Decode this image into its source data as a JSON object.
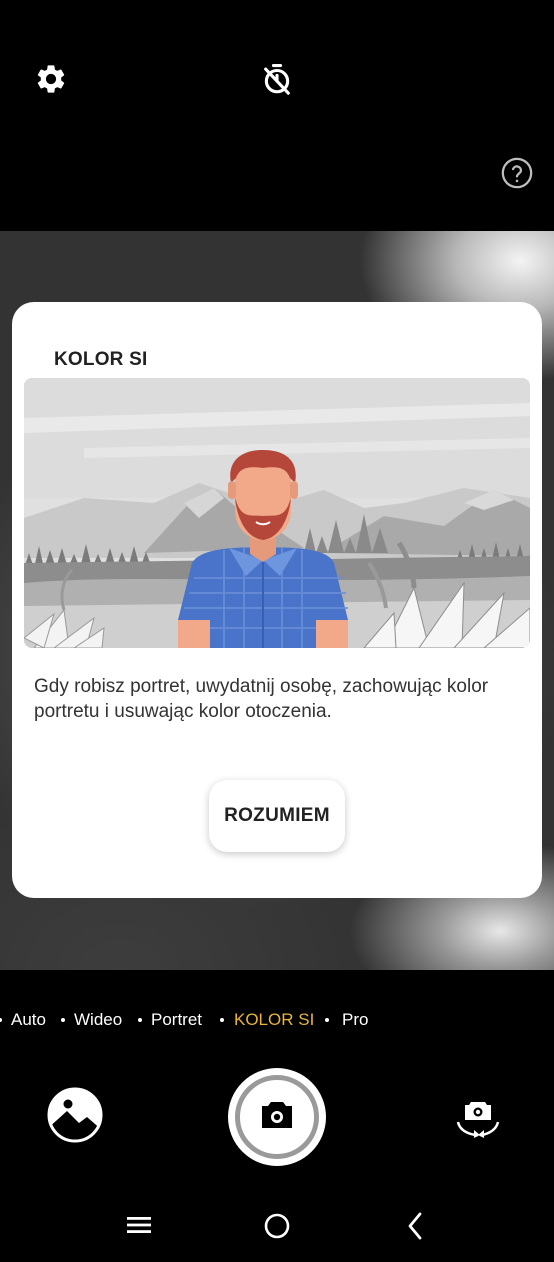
{
  "top_bar": {
    "settings_icon": "gear-icon",
    "timer_icon": "timer-off-icon",
    "help_icon": "help-circle-icon"
  },
  "dialog": {
    "title": "KOLOR SI",
    "description": "Gdy robisz portret, uwydatnij osobę, zachowując kolor portretu i usuwając kolor otoczenia.",
    "button_label": "ROZUMIEM",
    "illustration_colors": {
      "shirt": "#4a74c9",
      "hair": "#b5473a",
      "skin": "#f2a98a"
    }
  },
  "modes": {
    "items": [
      "Auto",
      "Wideo",
      "Portret",
      "KOLOR SI",
      "Pro"
    ],
    "active": "KOLOR SI",
    "active_color": "#e8b43c"
  },
  "bottom_controls": {
    "gallery_icon": "gallery-icon",
    "shutter_icon": "camera-icon",
    "switch_camera_icon": "flip-camera-icon"
  },
  "nav_bar": {
    "recents_icon": "menu-icon",
    "home_icon": "home-circle-icon",
    "back_icon": "chevron-left-icon"
  }
}
